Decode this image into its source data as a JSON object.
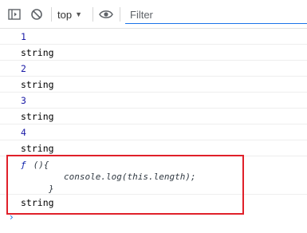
{
  "toolbar": {
    "context_label": "top",
    "filter_placeholder": "Filter",
    "icons": [
      "sidebar-toggle-icon",
      "clear-console-icon",
      "chevron-down-icon",
      "eye-icon"
    ]
  },
  "console": {
    "lines": [
      {
        "text": "1",
        "kind": "number"
      },
      {
        "text": "string",
        "kind": "string"
      },
      {
        "text": "2",
        "kind": "number"
      },
      {
        "text": "string",
        "kind": "string"
      },
      {
        "text": "3",
        "kind": "number"
      },
      {
        "text": "string",
        "kind": "string"
      },
      {
        "text": "4",
        "kind": "number"
      },
      {
        "text": "string",
        "kind": "string"
      }
    ],
    "function_output": {
      "line1_kw": "ƒ",
      "line1_rest": " (){",
      "line2": "console.log(this.length);",
      "line3": "}"
    },
    "last_line": "string",
    "prompt_glyph": "›"
  },
  "colors": {
    "number": "#1a1aa6",
    "highlight_border": "#e0202a",
    "accent": "#1a73e8"
  }
}
